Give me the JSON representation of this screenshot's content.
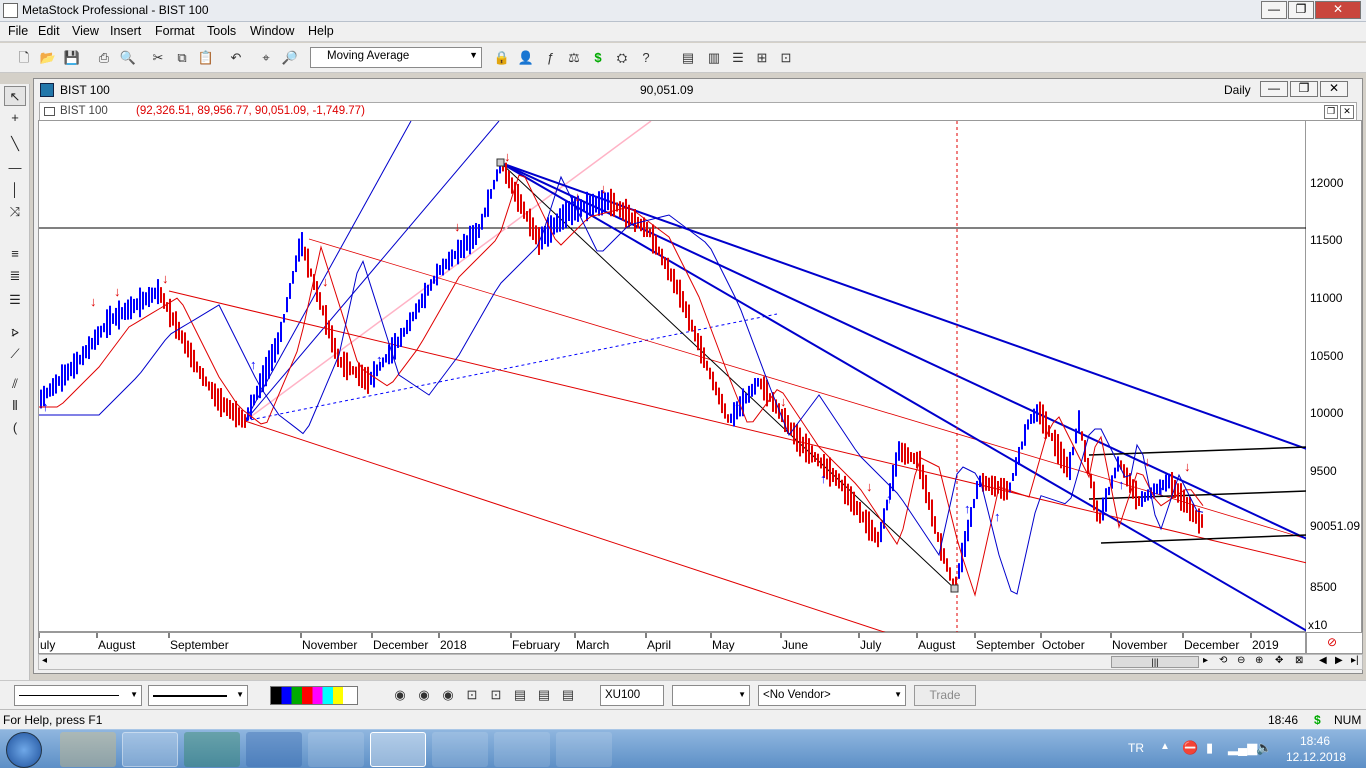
{
  "window": {
    "title": "MetaStock Professional - BIST 100",
    "min": "—",
    "max": "❐",
    "close": "✕"
  },
  "menu": [
    "File",
    "Edit",
    "View",
    "Insert",
    "Format",
    "Tools",
    "Window",
    "Help"
  ],
  "toolbar": {
    "indicator_select": "Moving Average"
  },
  "chart_window": {
    "title": "BIST 100",
    "last_value": "90,051.09",
    "period": "Daily",
    "legend_name": "BIST 100",
    "legend_values": "(92,326.51, 89,956.77, 90,051.09, -1,749.77)"
  },
  "chart_data": {
    "type": "bar",
    "title": "BIST 100",
    "price_ticks": [
      12000,
      11500,
      11000,
      10500,
      10000,
      9500,
      9000,
      8500
    ],
    "price_tick_labels": [
      "12000",
      "11500",
      "11000",
      "10500",
      "10000",
      "9500",
      "90051.09",
      "8500"
    ],
    "scale_label": "x10",
    "last_price_label": "90051.09",
    "date_labels": [
      "uly",
      "August",
      "September",
      "November",
      "December",
      "2018",
      "February",
      "March",
      "April",
      "May",
      "June",
      "July",
      "August",
      "September",
      "October",
      "November",
      "December",
      "2019"
    ],
    "up_color": "#0000ff",
    "down_color": "#e00000"
  },
  "toolbar2": {
    "symbol": "XU100",
    "vendor": "<No Vendor>",
    "trade": "Trade"
  },
  "status": {
    "help": "For Help, press F1",
    "time": "18:46",
    "dollar": "$",
    "num": "NUM"
  },
  "taskbar": {
    "lang": "TR",
    "clock_time": "18:46",
    "clock_date": "12.12.2018"
  }
}
